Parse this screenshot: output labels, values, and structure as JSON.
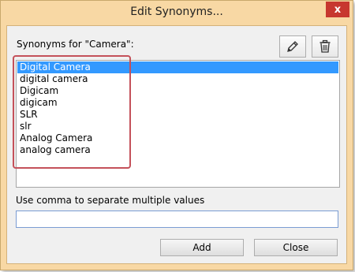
{
  "window": {
    "title": "Edit Synonyms...",
    "close_glyph": "x"
  },
  "synonyms": {
    "label": "Synonyms for \"Camera\":",
    "items": [
      {
        "text": "Digital Camera",
        "selected": true
      },
      {
        "text": "digital camera",
        "selected": false
      },
      {
        "text": "Digicam",
        "selected": false
      },
      {
        "text": "digicam",
        "selected": false
      },
      {
        "text": "SLR",
        "selected": false
      },
      {
        "text": "slr",
        "selected": false
      },
      {
        "text": "Analog Camera",
        "selected": false
      },
      {
        "text": "analog camera",
        "selected": false
      }
    ]
  },
  "toolbar": {
    "edit_icon": "pencil-icon",
    "delete_icon": "trash-icon"
  },
  "input": {
    "hint": "Use comma to separate multiple values",
    "value": ""
  },
  "buttons": {
    "add": "Add",
    "close": "Close"
  },
  "colors": {
    "selection": "#3399ff",
    "highlight_box": "#c4515a",
    "frame": "#f8d8a4",
    "close_button": "#c7372f"
  }
}
